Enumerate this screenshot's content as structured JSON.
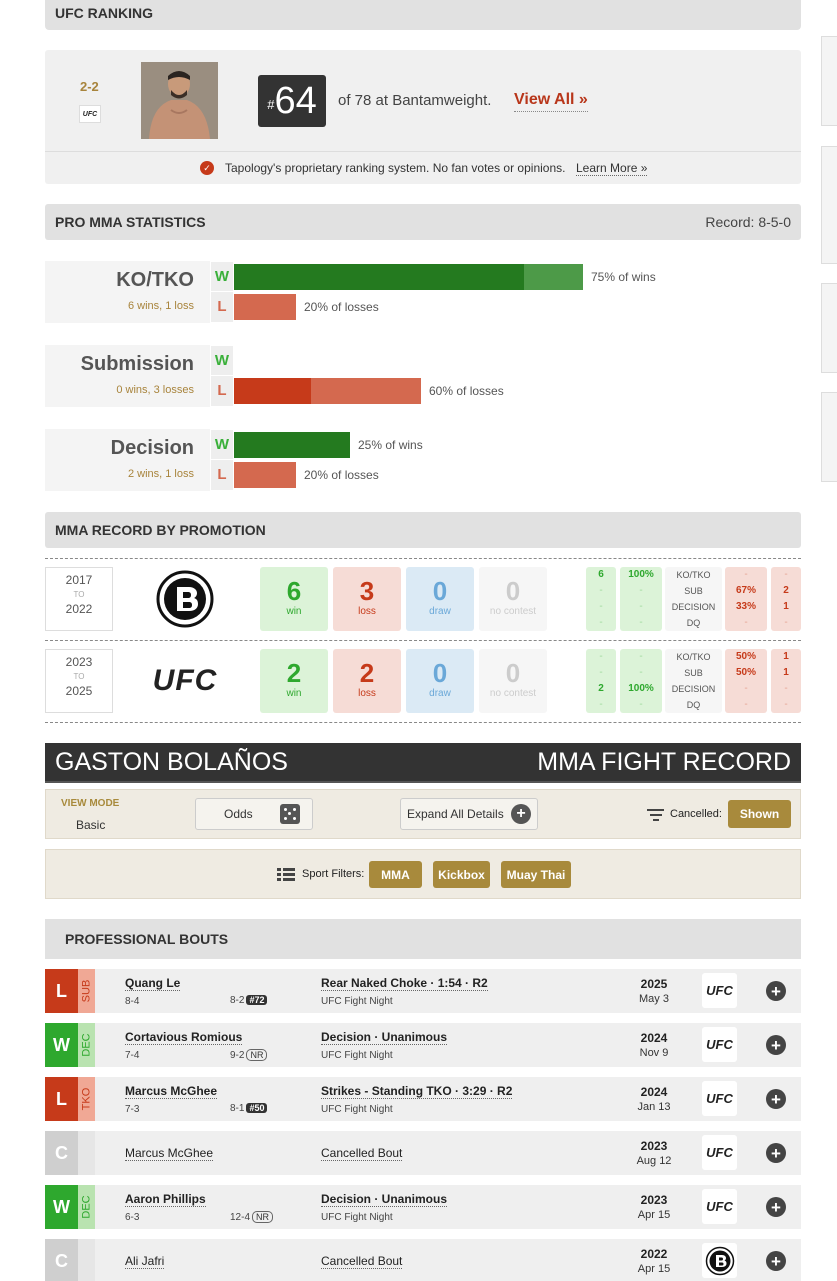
{
  "ufc_ranking": {
    "title": "UFC RANKING",
    "record": "2-2",
    "promo_mini": "UFC",
    "rank_hash": "#",
    "rank_num": "64",
    "rank_text": "of 78 at Bantamweight.",
    "view_all": "View All »",
    "note": "Tapology's proprietary ranking system. No fan votes or opinions.",
    "learn_more": "Learn More »"
  },
  "pro_stats": {
    "title": "PRO MMA STATISTICS",
    "record": "Record: 8-5-0",
    "w_letter": "W",
    "l_letter": "L",
    "rows": [
      {
        "name": "KO/TKO",
        "sub": "6 wins, 1 loss",
        "win_pct": 75,
        "loss_pct": 20,
        "win_label": "75% of wins",
        "loss_label": "20% of losses"
      },
      {
        "name": "Submission",
        "sub": "0 wins, 3 losses",
        "win_pct": 0,
        "loss_pct": 60,
        "win_label": "",
        "loss_label": "60% of losses"
      },
      {
        "name": "Decision",
        "sub": "2 wins, 1 loss",
        "win_pct": 25,
        "loss_pct": 20,
        "win_label": "25% of wins",
        "loss_label": "20% of losses"
      }
    ]
  },
  "promotion": {
    "title": "MMA RECORD BY PROMOTION",
    "to": "TO",
    "rows": [
      {
        "start": "2017",
        "end": "2022",
        "logo": "bellator-logo",
        "win": "6",
        "loss": "3",
        "draw": "0",
        "nc": "0",
        "win_label": "win",
        "loss_label": "loss",
        "draw_label": "draw",
        "nc_label": "no contest",
        "wcount": [
          "6",
          "-",
          "-",
          "-"
        ],
        "wpct": [
          "100%",
          "-",
          "-",
          "-"
        ],
        "methods": [
          "KO/TKO",
          "SUB",
          "DECISION",
          "DQ"
        ],
        "lpct": [
          "-",
          "67%",
          "33%",
          "-"
        ],
        "lcount": [
          "-",
          "2",
          "1",
          "-"
        ]
      },
      {
        "start": "2023",
        "end": "2025",
        "logo": "ufc-logo",
        "logo_text": "UFC",
        "win": "2",
        "loss": "2",
        "draw": "0",
        "nc": "0",
        "win_label": "win",
        "loss_label": "loss",
        "draw_label": "draw",
        "nc_label": "no contest",
        "wcount": [
          "-",
          "-",
          "2",
          "-"
        ],
        "wpct": [
          "-",
          "-",
          "100%",
          "-"
        ],
        "methods": [
          "KO/TKO",
          "SUB",
          "DECISION",
          "DQ"
        ],
        "lpct": [
          "50%",
          "50%",
          "-",
          "-"
        ],
        "lcount": [
          "1",
          "1",
          "-",
          "-"
        ]
      }
    ]
  },
  "fight_header": {
    "name": "GASTON BOLAÑOS",
    "right": "MMA FIGHT RECORD"
  },
  "controls": {
    "view_mode_label": "VIEW MODE",
    "view_mode_value": "Basic",
    "odds": "Odds",
    "expand": "Expand All Details",
    "cancelled_label": "Cancelled:",
    "shown": "Shown",
    "sport_filters": "Sport Filters:",
    "filters": [
      "MMA",
      "Kickbox",
      "Muay Thai"
    ]
  },
  "bouts": {
    "title": "PROFESSIONAL BOUTS",
    "items": [
      {
        "result": "L",
        "method": "SUB",
        "opponent": "Quang Le",
        "fighter_rec": "8-4",
        "opp_rec": "8-2",
        "rank": "#72",
        "rank_style": "dark",
        "fight": "Rear Naked Choke · 1:54 · R2",
        "event": "UFC Fight Night",
        "year": "2025",
        "date": "May 3",
        "promo": "UFC"
      },
      {
        "result": "W",
        "method": "DEC",
        "opponent": "Cortavious Romious",
        "fighter_rec": "7-4",
        "opp_rec": "9-2",
        "rank": "NR",
        "rank_style": "outline",
        "fight": "Decision · Unanimous",
        "event": "UFC Fight Night",
        "year": "2024",
        "date": "Nov 9",
        "promo": "UFC"
      },
      {
        "result": "L",
        "method": "TKO",
        "opponent": "Marcus McGhee",
        "fighter_rec": "7-3",
        "opp_rec": "8-1",
        "rank": "#50",
        "rank_style": "dark",
        "fight": "Strikes - Standing TKO · 3:29 · R2",
        "event": "UFC Fight Night",
        "year": "2024",
        "date": "Jan 13",
        "promo": "UFC"
      },
      {
        "result": "C",
        "method": "",
        "opponent": "Marcus McGhee",
        "fighter_rec": "",
        "opp_rec": "",
        "rank": "",
        "rank_style": "",
        "fight": "Cancelled Bout",
        "event": "",
        "year": "2023",
        "date": "Aug 12",
        "promo": "UFC"
      },
      {
        "result": "W",
        "method": "DEC",
        "opponent": "Aaron Phillips",
        "fighter_rec": "6-3",
        "opp_rec": "12-4",
        "rank": "NR",
        "rank_style": "outline",
        "fight": "Decision · Unanimous",
        "event": "UFC Fight Night",
        "year": "2023",
        "date": "Apr 15",
        "promo": "UFC"
      },
      {
        "result": "C",
        "method": "",
        "opponent": "Ali Jafri",
        "fighter_rec": "",
        "opp_rec": "",
        "rank": "",
        "rank_style": "",
        "fight": "Cancelled Bout",
        "event": "",
        "year": "2022",
        "date": "Apr 15",
        "promo": "bellator"
      }
    ]
  },
  "colors": {
    "win": "#247a1f",
    "loss": "#c63a1a",
    "cancel": "#cfcfcf",
    "gold": "#a88a3c"
  }
}
